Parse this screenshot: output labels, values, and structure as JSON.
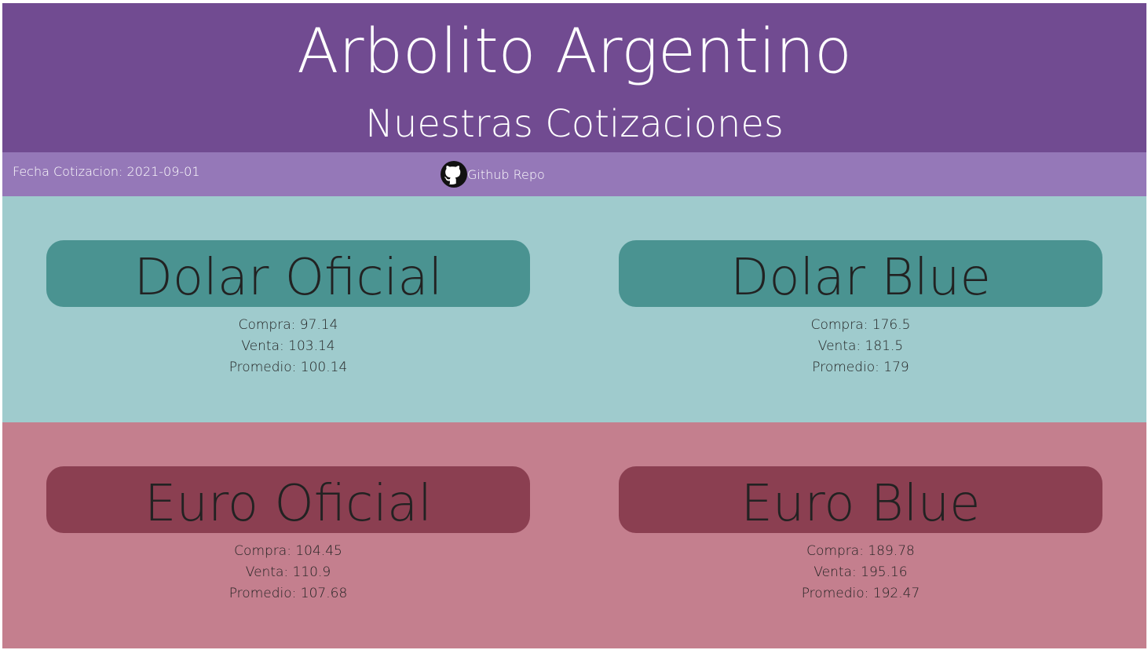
{
  "header": {
    "title": "Arbolito Argentino",
    "subtitle": "Nuestras Cotizaciones"
  },
  "infobar": {
    "fecha_label": "Fecha Cotizacion: ",
    "fecha_value": "2021-09-01",
    "repo_label": "Github Repo",
    "repo_icon": "github-icon"
  },
  "colors": {
    "header_bg": "#714b91",
    "infobar_bg": "#9578b8",
    "dolar_section_bg": "#9fcbcd",
    "dolar_pill_bg": "#4a9391",
    "euro_section_bg": "#c47f8e",
    "euro_pill_bg": "#8b3f51"
  },
  "cotizaciones": {
    "dolar_oficial": {
      "nombre": "Dolar Oficial",
      "compra_label": "Compra: ",
      "compra": "97.14",
      "venta_label": "Venta: ",
      "venta": "103.14",
      "promedio_label": "Promedio: ",
      "promedio": "100.14"
    },
    "dolar_blue": {
      "nombre": "Dolar Blue",
      "compra_label": "Compra: ",
      "compra": "176.5",
      "venta_label": "Venta: ",
      "venta": "181.5",
      "promedio_label": "Promedio: ",
      "promedio": "179"
    },
    "euro_oficial": {
      "nombre": "Euro Oficial",
      "compra_label": "Compra: ",
      "compra": "104.45",
      "venta_label": "Venta: ",
      "venta": "110.9",
      "promedio_label": "Promedio: ",
      "promedio": "107.68"
    },
    "euro_blue": {
      "nombre": "Euro Blue",
      "compra_label": "Compra: ",
      "compra": "189.78",
      "venta_label": "Venta: ",
      "venta": "195.16",
      "promedio_label": "Promedio: ",
      "promedio": "192.47"
    }
  }
}
